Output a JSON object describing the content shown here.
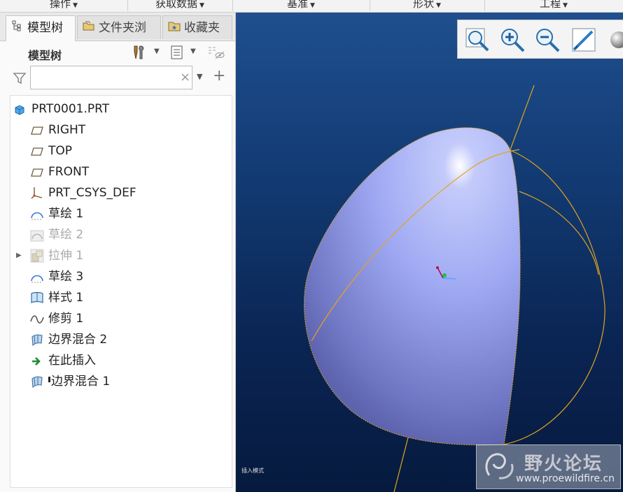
{
  "ribbon": {
    "groups": [
      "操作",
      "获取数据",
      "基准",
      "形状",
      "工程"
    ]
  },
  "tabs": [
    {
      "label": "模型树",
      "icon": "model-tree-icon"
    },
    {
      "label": "文件夹浏",
      "icon": "folder-browser-icon"
    },
    {
      "label": "收藏夹",
      "icon": "favorites-icon"
    }
  ],
  "tree_header": {
    "title": "模型树"
  },
  "filter": {
    "value": "",
    "placeholder": ""
  },
  "tree": {
    "items": [
      {
        "label": "PRT0001.PRT",
        "icon": "part-cube-icon",
        "state": "normal"
      },
      {
        "label": "RIGHT",
        "icon": "datum-plane-icon",
        "state": "normal"
      },
      {
        "label": "TOP",
        "icon": "datum-plane-icon",
        "state": "normal"
      },
      {
        "label": "FRONT",
        "icon": "datum-plane-icon",
        "state": "normal"
      },
      {
        "label": "PRT_CSYS_DEF",
        "icon": "coordinate-system-icon",
        "state": "normal"
      },
      {
        "label": "草绘 1",
        "icon": "sketch-icon",
        "state": "normal"
      },
      {
        "label": "草绘 2",
        "icon": "sketch-icon",
        "state": "suppressed"
      },
      {
        "label": "拉伸 1",
        "icon": "extrude-icon",
        "state": "suppressed"
      },
      {
        "label": "草绘 3",
        "icon": "sketch-icon",
        "state": "normal"
      },
      {
        "label": "样式 1",
        "icon": "style-icon",
        "state": "normal"
      },
      {
        "label": "修剪 1",
        "icon": "trim-icon",
        "state": "normal"
      },
      {
        "label": "边界混合 2",
        "icon": "boundary-blend-icon",
        "state": "normal"
      },
      {
        "label": "在此插入",
        "icon": "insert-here-arrow-icon",
        "state": "normal"
      },
      {
        "label": "边界混合 1",
        "icon": "boundary-blend-icon",
        "state": "normal"
      }
    ]
  },
  "view_toolbar": {
    "buttons": [
      "refit-icon",
      "zoom-in-icon",
      "zoom-out-icon",
      "repaint-icon",
      "display-style-icon"
    ]
  },
  "viewport": {
    "status_text": "插入模式"
  },
  "watermark": {
    "title": "野火论坛",
    "url": "www.proewildfire.cn"
  },
  "colors": {
    "surface": "#9ea8f2",
    "curve": "#e2a51c",
    "background_top": "#1f4f8f",
    "background_bottom": "#061a3e"
  }
}
